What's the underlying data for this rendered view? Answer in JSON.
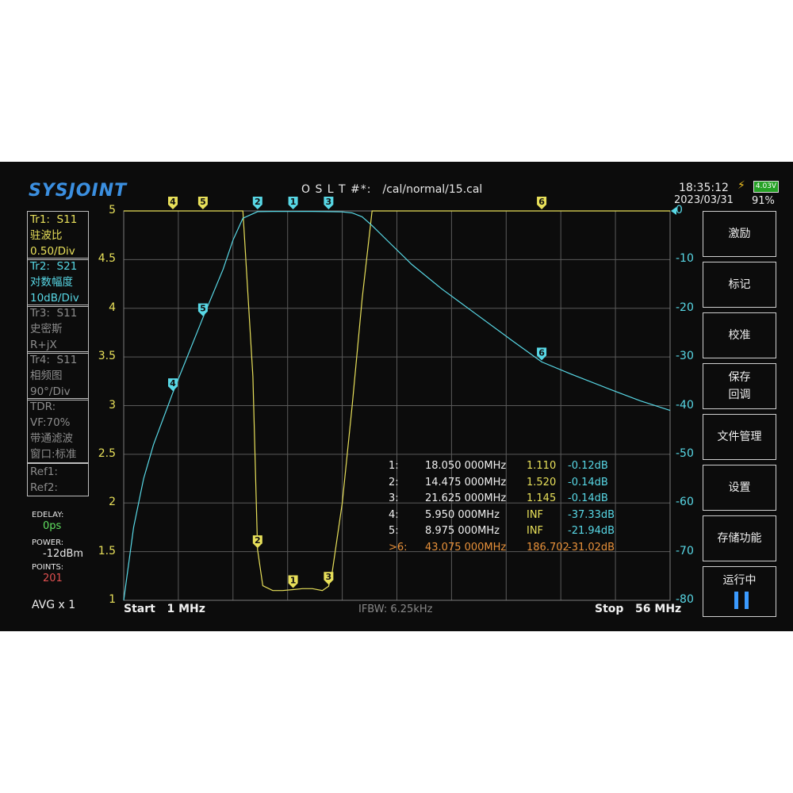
{
  "header": {
    "logo": "SYSJOINT",
    "cal_label": "O S L T #*:",
    "cal_path": "/cal/normal/15.cal",
    "time": "18:35:12",
    "date": "2023/03/31",
    "battery_voltage": "4.03V",
    "battery_percent": "91%"
  },
  "traces": [
    {
      "id": "Tr1:",
      "param": "S11",
      "format": "驻波比",
      "scale": "0.50/Div",
      "color": "#e8e05a"
    },
    {
      "id": "Tr2:",
      "param": "S21",
      "format": "对数幅度",
      "scale": "10dB/Div",
      "color": "#58d8e6"
    },
    {
      "id": "Tr3:",
      "param": "S11",
      "format": "史密斯",
      "scale": "R+jX",
      "color": "#8c8c8c"
    },
    {
      "id": "Tr4:",
      "param": "S11",
      "format": "相频图",
      "scale": "90°/Div",
      "color": "#8c8c8c"
    }
  ],
  "tdr": {
    "title": "TDR:",
    "vf": "VF:70%",
    "filter": "带通滤波",
    "window": "窗口:标准"
  },
  "refs": {
    "ref1": "Ref1:",
    "ref2": "Ref2:"
  },
  "settings": {
    "edelay_label": "EDELAY:",
    "edelay_value": "0ps",
    "power_label": "POWER:",
    "power_value": "-12dBm",
    "points_label": "POINTS:",
    "points_value": "201",
    "avg": "AVG x 1"
  },
  "menu": [
    "激励",
    "标记",
    "校准",
    "保存\n回调",
    "文件管理",
    "设置",
    "存储功能"
  ],
  "run_button": {
    "label": "运行中"
  },
  "axes": {
    "left_ticks": [
      "5",
      "4.5",
      "4",
      "3.5",
      "3",
      "2.5",
      "2",
      "1.5",
      "1"
    ],
    "right_ticks": [
      "0",
      "-10",
      "-20",
      "-30",
      "-40",
      "-50",
      "-60",
      "-70",
      "-80"
    ],
    "start_label": "Start",
    "start_value": "1 MHz",
    "stop_label": "Stop",
    "stop_value": "56 MHz",
    "ifbw": "IFBW: 6.25kHz"
  },
  "markers": [
    {
      "id": "1:",
      "freq": "18.050 000MHz",
      "swr": "1.110",
      "db": "-0.12dB",
      "active": false
    },
    {
      "id": "2:",
      "freq": "14.475 000MHz",
      "swr": "1.520",
      "db": "-0.14dB",
      "active": false
    },
    {
      "id": "3:",
      "freq": "21.625 000MHz",
      "swr": "1.145",
      "db": "-0.14dB",
      "active": false
    },
    {
      "id": "4:",
      "freq": "5.950 000MHz",
      "swr": "INF",
      "db": "-37.33dB",
      "active": false
    },
    {
      "id": "5:",
      "freq": "8.975 000MHz",
      "swr": "INF",
      "db": "-21.94dB",
      "active": false
    },
    {
      "id": ">6:",
      "freq": "43.075 000MHz",
      "swr": "186.702",
      "db": "-31.02dB",
      "active": true
    }
  ],
  "chart_data": {
    "type": "line",
    "x_range_mhz": [
      1,
      56
    ],
    "left_axis": {
      "range": [
        1,
        5
      ],
      "unit": "SWR"
    },
    "right_axis": {
      "range": [
        -80,
        0
      ],
      "unit": "dB"
    },
    "grid": true,
    "series": [
      {
        "name": "S11",
        "color": "#e8e05a",
        "x": [
          1,
          10,
          11,
          12,
          13,
          14,
          14.475,
          15,
          16,
          17,
          18.05,
          19,
          20,
          21,
          21.625,
          22,
          23,
          24,
          25,
          26,
          27,
          56
        ],
        "y": [
          5,
          5,
          5,
          5,
          5,
          3.3,
          1.52,
          1.15,
          1.1,
          1.1,
          1.11,
          1.12,
          1.12,
          1.1,
          1.145,
          1.3,
          2.0,
          3.0,
          4.1,
          5,
          5,
          5
        ]
      },
      {
        "name": "S21",
        "color": "#58d8e6",
        "x": [
          1,
          2,
          3,
          4,
          5.95,
          8.975,
          11,
          12,
          13,
          14.475,
          16,
          18.05,
          20,
          21.625,
          23,
          24,
          25,
          26,
          28,
          30,
          33,
          36,
          40,
          43.075,
          46,
          50,
          53,
          56
        ],
        "y": [
          -80,
          -65,
          -55,
          -48,
          -37.33,
          -21.94,
          -12,
          -6,
          -1.5,
          -0.14,
          -0.1,
          -0.12,
          -0.1,
          -0.14,
          -0.2,
          -0.4,
          -1.2,
          -3,
          -7,
          -11,
          -16,
          -20.5,
          -26.5,
          -31.02,
          -33.5,
          -36.7,
          -39,
          -41
        ]
      }
    ],
    "markers": [
      {
        "n": "1",
        "x": 18.05,
        "swr": 1.11,
        "db": -0.12
      },
      {
        "n": "2",
        "x": 14.475,
        "swr": 1.52,
        "db": -0.14
      },
      {
        "n": "3",
        "x": 21.625,
        "swr": 1.145,
        "db": -0.14
      },
      {
        "n": "4",
        "x": 5.95,
        "db": -37.33
      },
      {
        "n": "5",
        "x": 8.975,
        "db": -21.94
      },
      {
        "n": "6",
        "x": 43.075,
        "db": -31.02
      }
    ]
  }
}
